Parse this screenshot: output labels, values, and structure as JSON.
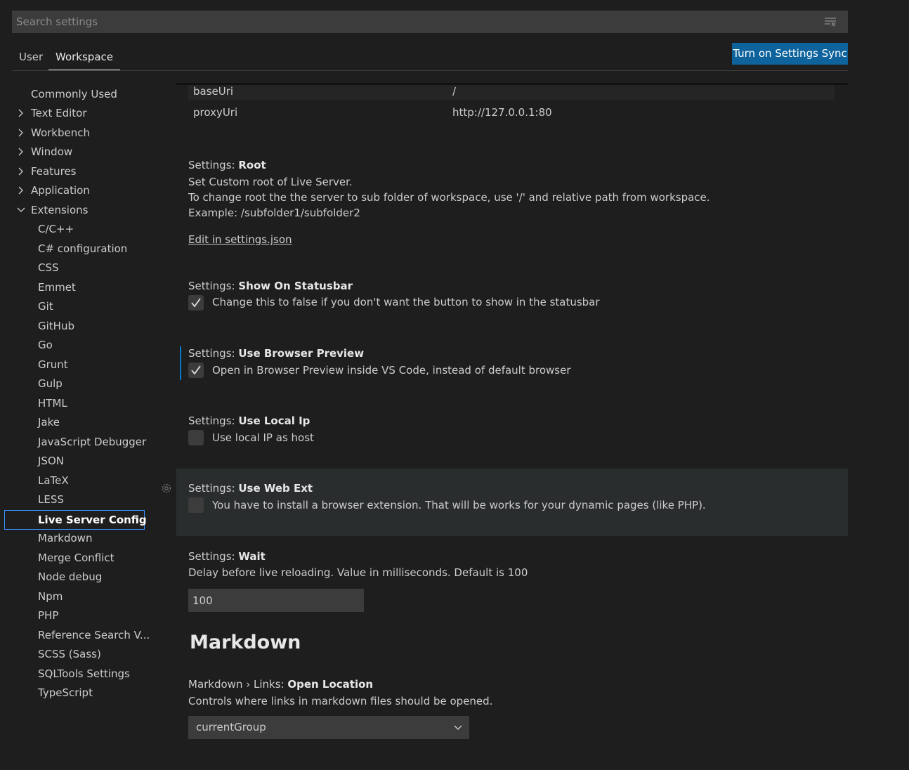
{
  "search": {
    "placeholder": "Search settings"
  },
  "tabs": [
    {
      "label": "User"
    },
    {
      "label": "Workspace"
    }
  ],
  "sync_button": "Turn on Settings Sync",
  "tree": {
    "top": [
      {
        "label": "Commonly Used"
      },
      {
        "label": "Text Editor"
      },
      {
        "label": "Workbench"
      },
      {
        "label": "Window"
      },
      {
        "label": "Features"
      },
      {
        "label": "Application"
      },
      {
        "label": "Extensions"
      }
    ],
    "extensions": [
      {
        "label": "C/C++"
      },
      {
        "label": "C# configuration"
      },
      {
        "label": "CSS"
      },
      {
        "label": "Emmet"
      },
      {
        "label": "Git"
      },
      {
        "label": "GitHub"
      },
      {
        "label": "Go"
      },
      {
        "label": "Grunt"
      },
      {
        "label": "Gulp"
      },
      {
        "label": "HTML"
      },
      {
        "label": "Jake"
      },
      {
        "label": "JavaScript Debugger"
      },
      {
        "label": "JSON"
      },
      {
        "label": "LaTeX"
      },
      {
        "label": "LESS"
      },
      {
        "label": "Live Server Config"
      },
      {
        "label": "Markdown"
      },
      {
        "label": "Merge Conflict"
      },
      {
        "label": "Node debug"
      },
      {
        "label": "Npm"
      },
      {
        "label": "PHP"
      },
      {
        "label": "Reference Search V..."
      },
      {
        "label": "SCSS (Sass)"
      },
      {
        "label": "SQLTools Settings"
      },
      {
        "label": "TypeScript"
      }
    ]
  },
  "table": {
    "rows": [
      {
        "key": "baseUri",
        "value": "/"
      },
      {
        "key": "proxyUri",
        "value": "http://127.0.0.1:80"
      }
    ]
  },
  "settings": {
    "root": {
      "prefix": "Settings: ",
      "name": "Root",
      "desc1": "Set Custom root of Live Server.",
      "desc2": "To change root the the server to sub folder of workspace, use '/' and relative path from workspace.",
      "desc3": "Example: /subfolder1/subfolder2",
      "link": "Edit in settings.json"
    },
    "show_on_statusbar": {
      "prefix": "Settings: ",
      "name": "Show On Statusbar",
      "desc": "Change this to false if you don't want the button to show in the statusbar",
      "checked": true
    },
    "use_browser_preview": {
      "prefix": "Settings: ",
      "name": "Use Browser Preview",
      "desc": "Open in Browser Preview inside VS Code, instead of default browser",
      "checked": true
    },
    "use_local_ip": {
      "prefix": "Settings: ",
      "name": "Use Local Ip",
      "desc": "Use local IP as host",
      "checked": false
    },
    "use_web_ext": {
      "prefix": "Settings: ",
      "name": "Use Web Ext",
      "desc": "You have to install a browser extension. That will be works for your dynamic pages (like PHP).",
      "checked": false
    },
    "wait": {
      "prefix": "Settings: ",
      "name": "Wait",
      "desc": "Delay before live reloading. Value in milliseconds. Default is 100",
      "value": "100"
    }
  },
  "markdown": {
    "heading": "Markdown",
    "links_open_location": {
      "prefix": "Markdown › Links: ",
      "name": "Open Location",
      "desc": "Controls where links in markdown files should be opened.",
      "value": "currentGroup"
    }
  },
  "colors": {
    "accent": "#0e639c",
    "focus": "#007acc",
    "background": "#1e1e1e"
  }
}
